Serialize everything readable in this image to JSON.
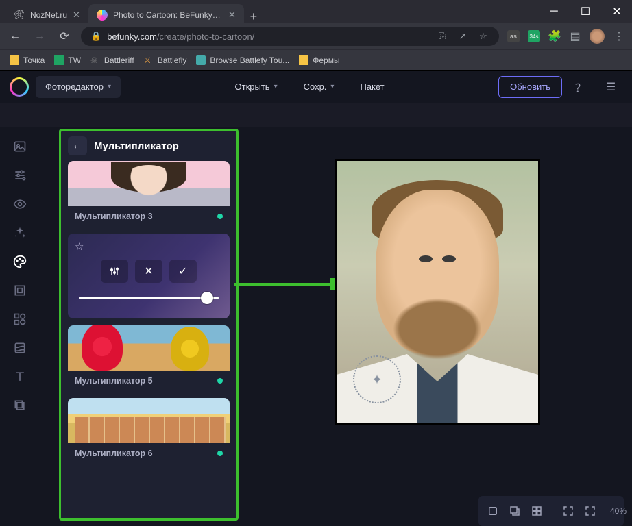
{
  "browser": {
    "tabs": [
      {
        "title": "NozNet.ru",
        "favicon": "🛠",
        "active": false
      },
      {
        "title": "Photo to Cartoon: BeFunky - Cart",
        "favicon": "◌",
        "active": true
      }
    ],
    "url_host": "befunky.com",
    "url_path": "/create/photo-to-cartoon/",
    "bookmarks": [
      {
        "label": "Точка",
        "color": "#f6c445"
      },
      {
        "label": "TW",
        "color": "#1fa463"
      },
      {
        "label": "Battleriff",
        "color": "#888"
      },
      {
        "label": "Battlefly",
        "color": "#d94"
      },
      {
        "label": "Browse Battlefy Tou...",
        "color": "#4aa"
      },
      {
        "label": "Фермы",
        "color": "#f6c445"
      }
    ],
    "ext_badge": "34s"
  },
  "app": {
    "editor_label": "Фоторедактор",
    "open_label": "Открыть",
    "save_label": "Сохр.",
    "batch_label": "Пакет",
    "update_label": "Обновить"
  },
  "panel": {
    "title": "Мультипликатор",
    "effects": {
      "e3": "Мультипликатор 3",
      "e5": "Мультипликатор 5",
      "e6": "Мультипликатор 6"
    }
  },
  "zoom": {
    "value": "40%"
  },
  "colors": {
    "highlight": "#3dbf2e",
    "accent": "#6d6df7",
    "plus_dot": "#1fd6a8"
  }
}
